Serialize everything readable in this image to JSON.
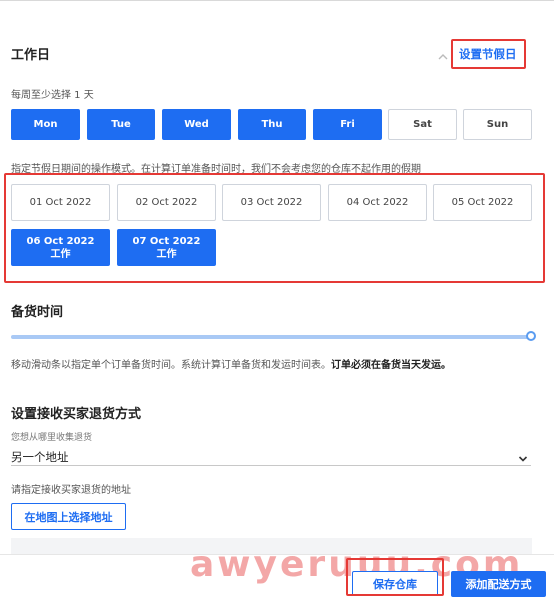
{
  "workdays": {
    "title": "工作日",
    "holiday_button": "设置节假日",
    "min_note": "每周至少选择 1 天",
    "days": [
      {
        "label": "Mon",
        "on": true
      },
      {
        "label": "Tue",
        "on": true
      },
      {
        "label": "Wed",
        "on": true
      },
      {
        "label": "Thu",
        "on": true
      },
      {
        "label": "Fri",
        "on": true
      },
      {
        "label": "Sat",
        "on": false
      },
      {
        "label": "Sun",
        "on": false
      }
    ],
    "holiday_note": "指定节假日期间的操作模式。在计算订单准备时间时，我们不会考虑您的仓库不起作用的假期",
    "dates": [
      {
        "date": "01 Oct 2022",
        "status": ""
      },
      {
        "date": "02 Oct 2022",
        "status": ""
      },
      {
        "date": "03 Oct 2022",
        "status": ""
      },
      {
        "date": "04 Oct 2022",
        "status": ""
      },
      {
        "date": "05 Oct 2022",
        "status": ""
      },
      {
        "date": "06 Oct 2022",
        "status": "工作"
      },
      {
        "date": "07 Oct 2022",
        "status": "工作"
      }
    ]
  },
  "stocking": {
    "title": "备货时间",
    "slider_value": 1.0,
    "note_main": "移动滑动条以指定单个订单备货时间。系统计算订单备货和发运时间表。",
    "note_bold": "订单必须在备货当天发运。"
  },
  "returns": {
    "title": "设置接收买家退货方式",
    "select_label": "您想从哪里收集退货",
    "select_value": "另一个地址",
    "address_note": "请指定接收买家退货的地址",
    "map_button": "在地图上选择地址"
  },
  "footer": {
    "save_button": "保存仓库",
    "add_button": "添加配送方式"
  },
  "watermark": "awyeruuu.com",
  "colors": {
    "accent": "#1e6df2",
    "highlight": "#e53935"
  }
}
